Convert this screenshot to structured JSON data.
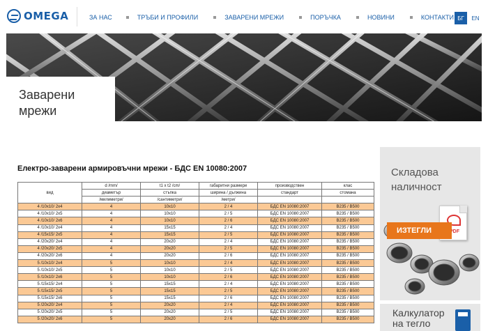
{
  "brand": {
    "name": "OMEGA",
    "color": "#1a5fa8"
  },
  "nav": [
    "ЗА НАС",
    "ТРЪБИ И ПРОФИЛИ",
    "ЗАВАРЕНИ МРЕЖИ",
    "ПОРЪЧКА",
    "НОВИНИ",
    "КОНТАКТИ"
  ],
  "lang": {
    "bg": "БГ",
    "en": "EN"
  },
  "hero": {
    "title_line1": "Заварени",
    "title_line2": "мрежи"
  },
  "main": {
    "title": "Електро-заварени армировъчни мрежи - БДС EN 10080:2007"
  },
  "table": {
    "head_kind": "вид",
    "head_row1": [
      "d /mm/",
      "t1 x t2 /cm/",
      "габаритни размери",
      "производствен",
      "клас"
    ],
    "head_row2": [
      "диаметър",
      "стъпка",
      "ширина / дължина",
      "стандарт",
      "стомана"
    ],
    "head_row3": [
      "/милиметри/",
      "/сантиметри/",
      "/метри/",
      "",
      ""
    ],
    "rows": [
      [
        "4 /10x10/ 2x4",
        "4",
        "10x10",
        "2 / 4",
        "БДС EN 10080:2007",
        "B235 / B500"
      ],
      [
        "4 /10x10/ 2x5",
        "4",
        "10x10",
        "2 / 5",
        "БДС EN 10080:2007",
        "B235 / B500"
      ],
      [
        "4 /10x10/ 2x6",
        "4",
        "10x10",
        "2 / 6",
        "БДС EN 10080:2007",
        "B235 / B500"
      ],
      [
        "4 /10x10/ 2x4",
        "4",
        "15x15",
        "2 / 4",
        "БДС EN 10080:2007",
        "B235 / B500"
      ],
      [
        "4 /15x15/ 2x5",
        "4",
        "15x15",
        "2 / 5",
        "БДС EN 10080:2007",
        "B235 / B500"
      ],
      [
        "4 /20x20/ 2x4",
        "4",
        "20x20",
        "2 / 4",
        "БДС EN 10080:2007",
        "B235 / B500"
      ],
      [
        "4 /20x20/ 2x5",
        "4",
        "20x20",
        "2 / 5",
        "БДС EN 10080:2007",
        "B235 / B500"
      ],
      [
        "4 /20x20/ 2x6",
        "4",
        "20x20",
        "2 / 6",
        "БДС EN 10080:2007",
        "B235 / B500"
      ],
      [
        "5 /10x10/ 2x4",
        "5",
        "10x10",
        "2 / 4",
        "БДС EN 10080:2007",
        "B235 / B500"
      ],
      [
        "5 /10x10/ 2x5",
        "5",
        "10x10",
        "2 / 5",
        "БДС EN 10080:2007",
        "B235 / B500"
      ],
      [
        "5 /10x10/ 2x6",
        "5",
        "10x10",
        "2 / 6",
        "БДС EN 10080:2007",
        "B235 / B500"
      ],
      [
        "5 /15x15/ 2x4",
        "5",
        "15x15",
        "2 / 4",
        "БДС EN 10080:2007",
        "B235 / B500"
      ],
      [
        "5 /15x15/ 2x5",
        "5",
        "15x15",
        "2 / 5",
        "БДС EN 10080:2007",
        "B235 / B500"
      ],
      [
        "5 /15x15/ 2x6",
        "5",
        "15x15",
        "2 / 6",
        "БДС EN 10080:2007",
        "B235 / B500"
      ],
      [
        "5 /20x20/ 2x4",
        "5",
        "20x20",
        "2 / 4",
        "БДС EN 10080:2007",
        "B235 / B500"
      ],
      [
        "5 /20x20/ 2x5",
        "5",
        "20x20",
        "2 / 5",
        "БДС EN 10080:2007",
        "B235 / B500"
      ],
      [
        "5 /20x20/ 2x6",
        "5",
        "20x20",
        "2 / 6",
        "БДС EN 10080:2007",
        "B235 / B500"
      ]
    ]
  },
  "sidebar": {
    "stock_line1": "Складова",
    "stock_line2": "наличност",
    "download": "ИЗТЕГЛИ",
    "pdf": "PDF",
    "calc_line1": "Калкулатор",
    "calc_line2": "на тегло"
  },
  "colors": {
    "accent_orange": "#e8761b",
    "row_highlight": "#fbc995",
    "card_bg": "#e7e7e7"
  }
}
